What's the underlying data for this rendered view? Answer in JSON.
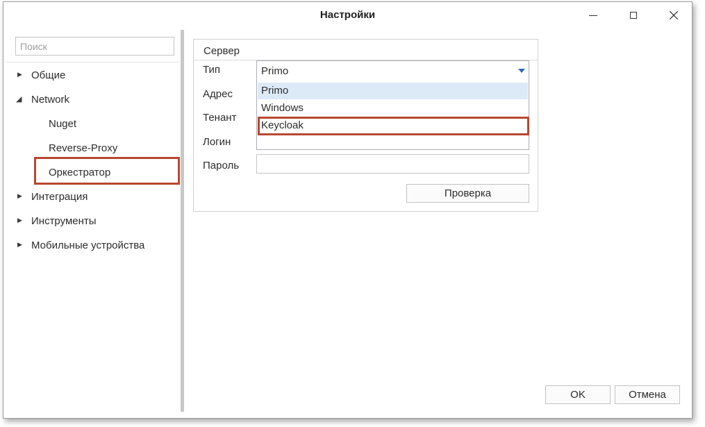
{
  "window": {
    "title": "Настройки"
  },
  "search": {
    "placeholder": "Поиск",
    "value": ""
  },
  "tree": {
    "items": [
      {
        "label": "Общие",
        "state": "collapsed"
      },
      {
        "label": "Network",
        "state": "expanded"
      },
      {
        "label": "Nuget"
      },
      {
        "label": "Reverse-Proxy"
      },
      {
        "label": "Оркестратор",
        "selected": true
      },
      {
        "label": "Интеграция",
        "state": "collapsed"
      },
      {
        "label": "Инструменты",
        "state": "collapsed"
      },
      {
        "label": "Мобильные устройства",
        "state": "collapsed"
      }
    ]
  },
  "server": {
    "title": "Сервер",
    "labels": {
      "type": "Тип",
      "address": "Адрес",
      "tenant": "Тенант",
      "login": "Логин",
      "password": "Пароль"
    },
    "type_value": "Primo",
    "type_options": [
      "Primo",
      "Windows",
      "Keycloak"
    ],
    "check_button": "Проверка"
  },
  "footer": {
    "ok": "OK",
    "cancel": "Отмена"
  },
  "colors": {
    "highlight": "#b7472f",
    "hover": "#dceaf8",
    "accent": "#2b6cb7"
  }
}
